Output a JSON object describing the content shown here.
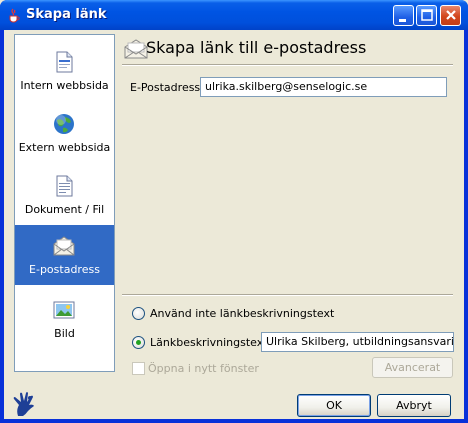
{
  "window": {
    "title": "Skapa länk",
    "controls": {
      "minimize": "minimize-icon",
      "maximize": "maximize-icon",
      "close": "close-icon"
    }
  },
  "nav": {
    "items": [
      {
        "label": "Intern webbsida",
        "icon": "document-icon",
        "selected": false
      },
      {
        "label": "Extern webbsida",
        "icon": "globe-icon",
        "selected": false
      },
      {
        "label": "Dokument / Fil",
        "icon": "file-icon",
        "selected": false
      },
      {
        "label": "E-postadress",
        "icon": "envelope-icon",
        "selected": true
      },
      {
        "label": "Bild",
        "icon": "image-icon",
        "selected": false
      }
    ]
  },
  "panel": {
    "title": "Skapa länk till e-postadress",
    "email_label": "E-Postadress:",
    "email_value": "ulrika.skilberg@senselogic.se"
  },
  "options": {
    "no_desc_label": "Använd inte länkbeskrivningstext",
    "desc_label": "Länkbeskrivningstext:",
    "desc_value": "Ulrika Skilberg, utbildningsansvarig på",
    "new_window_label": "Öppna i nytt fönster",
    "advanced_label": "Avancerat"
  },
  "footer": {
    "ok_label": "OK",
    "cancel_label": "Avbryt"
  },
  "colors": {
    "selection": "#316ac5",
    "titlebar": "#0054e3",
    "radio_dot": "#21a121"
  }
}
